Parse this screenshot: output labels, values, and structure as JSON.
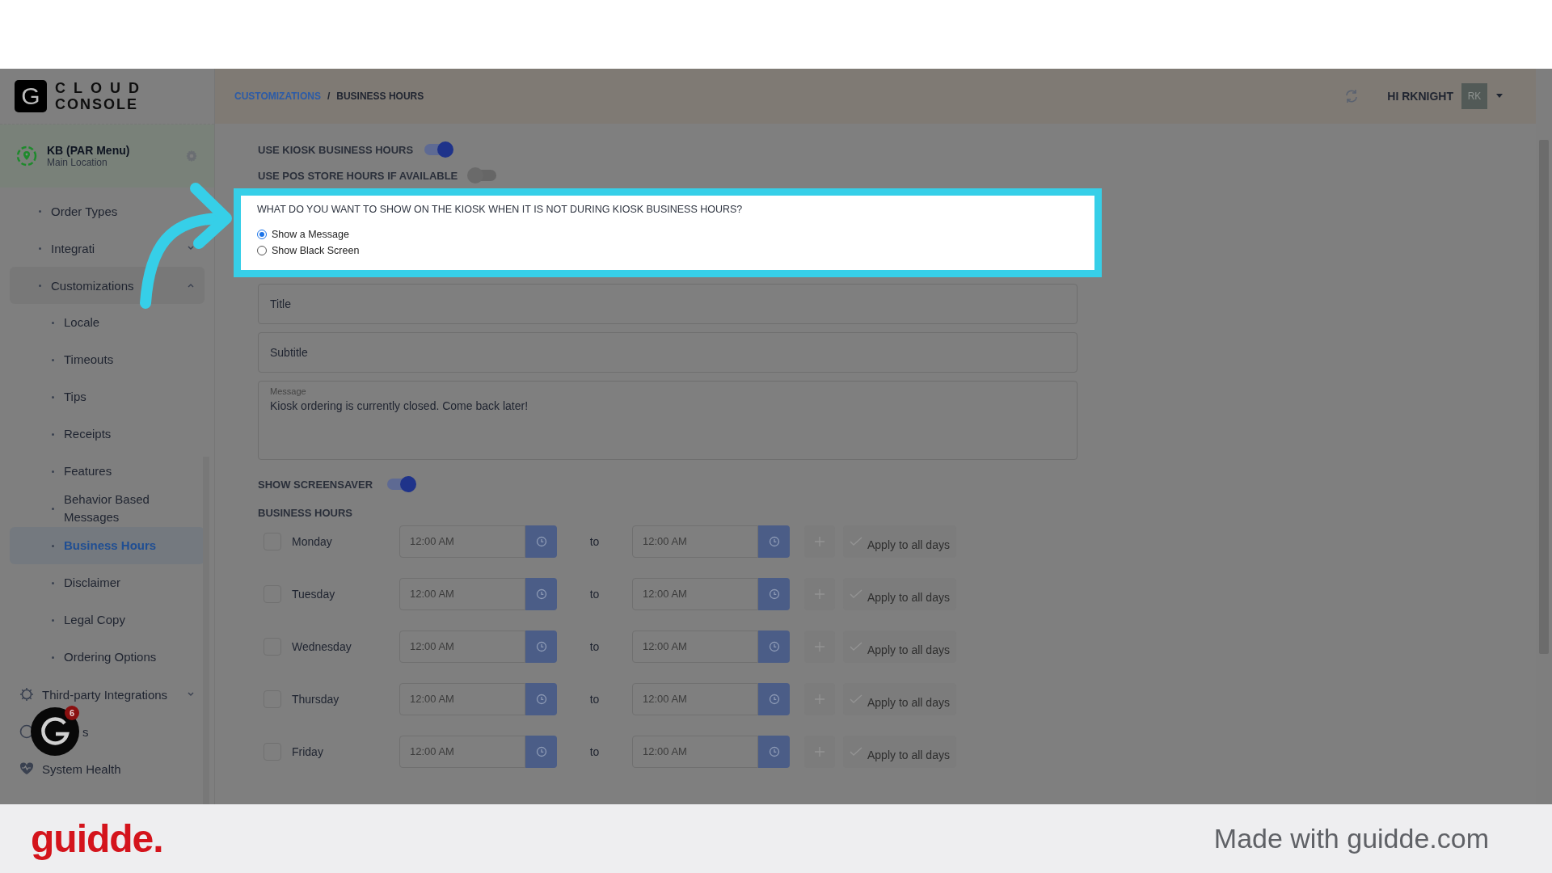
{
  "logo": {
    "mark": "G",
    "line_1": "CLOUD",
    "line_2": "CONSOLE"
  },
  "location": {
    "name": "KB (PAR Menu)",
    "subtitle": "Main Location"
  },
  "sidebar": {
    "items": [
      {
        "label": "Order Types",
        "kind": "bullet",
        "selected": false
      },
      {
        "label": "Integrati",
        "kind": "bullet",
        "selected": false,
        "expanded": false
      },
      {
        "label": "Customizations",
        "kind": "bullet",
        "selected": false,
        "expanded": true,
        "children": [
          {
            "label": "Locale",
            "selected": false
          },
          {
            "label": "Timeouts",
            "selected": false
          },
          {
            "label": "Tips",
            "selected": false
          },
          {
            "label": "Receipts",
            "selected": false
          },
          {
            "label": "Features",
            "selected": false
          },
          {
            "label": "Behavior Based Messages",
            "selected": false
          },
          {
            "label": "Business Hours",
            "selected": true
          },
          {
            "label": "Disclaimer",
            "selected": false
          },
          {
            "label": "Legal Copy",
            "selected": false
          },
          {
            "label": "Ordering Options",
            "selected": false
          }
        ]
      },
      {
        "label": "Third-party Integrations",
        "kind": "gear",
        "selected": false,
        "expanded": false
      },
      {
        "label": "s",
        "kind": "covered",
        "selected": false
      },
      {
        "label": "System Health",
        "kind": "heart",
        "selected": false
      }
    ]
  },
  "breadcrumb": [
    {
      "label": "CUSTOMIZATIONS",
      "kind": "link"
    },
    {
      "label": "/",
      "kind": "separator"
    },
    {
      "label": "BUSINESS HOURS",
      "kind": "current"
    }
  ],
  "user": {
    "greeting": "HI RKNIGHT",
    "initials": "RK"
  },
  "toggles": [
    {
      "label": "USE KIOSK BUSINESS HOURS",
      "on": true
    },
    {
      "label": "USE POS STORE HOURS IF AVAILABLE",
      "on": false
    }
  ],
  "question": {
    "text": "WHAT DO YOU WANT TO SHOW ON THE KIOSK WHEN IT IS NOT DURING KIOSK BUSINESS HOURS?",
    "options": [
      {
        "label": "Show a Message",
        "selected": true
      },
      {
        "label": "Show Black Screen",
        "selected": false
      }
    ]
  },
  "fields": [
    {
      "placeholder": "Title"
    },
    {
      "placeholder": "Subtitle"
    }
  ],
  "message": {
    "label": "Message",
    "value": "Kiosk ordering is currently closed. Come back later!"
  },
  "screensaver": {
    "label": "SHOW SCREENSAVER",
    "on": true
  },
  "business_hours": {
    "title": "BUSINESS HOURS",
    "days": [
      {
        "day": "Monday",
        "checked": false,
        "from": {
          "placeholder": "12:00 AM"
        },
        "to_label": "to",
        "to": {
          "placeholder": "12:00 AM"
        },
        "apply": "Apply to all days"
      },
      {
        "day": "Tuesday",
        "checked": false,
        "from": {
          "placeholder": "12:00 AM"
        },
        "to_label": "to",
        "to": {
          "placeholder": "12:00 AM"
        },
        "apply": "Apply to all days"
      },
      {
        "day": "Wednesday",
        "checked": false,
        "from": {
          "placeholder": "12:00 AM"
        },
        "to_label": "to",
        "to": {
          "placeholder": "12:00 AM"
        },
        "apply": "Apply to all days"
      },
      {
        "day": "Thursday",
        "checked": false,
        "from": {
          "placeholder": "12:00 AM"
        },
        "to_label": "to",
        "to": {
          "placeholder": "12:00 AM"
        },
        "apply": "Apply to all days"
      },
      {
        "day": "Friday",
        "checked": false,
        "from": {
          "placeholder": "12:00 AM"
        },
        "to_label": "to",
        "to": {
          "placeholder": "12:00 AM"
        },
        "apply": "Apply to all days"
      }
    ]
  },
  "help_widget": {
    "badge": "6"
  },
  "footer": {
    "brand": "guidde.",
    "credit": "Made with guidde.com"
  }
}
